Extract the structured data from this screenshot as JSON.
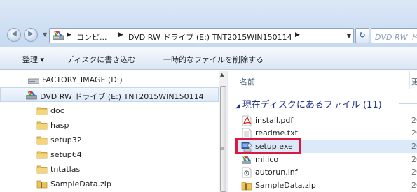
{
  "address_bar": {
    "crumbs": [
      "コンピ...",
      "DVD RW ドライブ (E:) TNT2015WIN150114"
    ],
    "search_placeholder": "DVD RW ドライブ"
  },
  "command_bar": {
    "organize": "整理 ▾",
    "burn": "ディスクに書き込む",
    "delete_temp": "一時的なファイルを削除する"
  },
  "nav_pane": {
    "items": [
      {
        "label": "FACTORY_IMAGE (D:)",
        "icon": "drive-icon",
        "selected": false
      },
      {
        "label": "DVD RW ドライブ (E:) TNT2015WIN150114",
        "icon": "dvd-drive-icon",
        "selected": true
      },
      {
        "label": "doc",
        "icon": "folder-icon"
      },
      {
        "label": "hasp",
        "icon": "folder-icon"
      },
      {
        "label": "setup32",
        "icon": "folder-icon"
      },
      {
        "label": "setup64",
        "icon": "folder-icon"
      },
      {
        "label": "tntatlas",
        "icon": "folder-icon"
      },
      {
        "label": "SampleData.zip",
        "icon": "zip-icon"
      }
    ]
  },
  "file_list": {
    "columns": {
      "name": "名前",
      "date": "更"
    },
    "group_title": "現在ディスクにあるファイル (11)",
    "files": [
      {
        "name": "install.pdf",
        "date": "20",
        "icon": "pdf-icon"
      },
      {
        "name": "readme.txt",
        "date": "20",
        "icon": "text-file-icon"
      },
      {
        "name": "setup.exe",
        "date": "20",
        "icon": "setup-exe-icon",
        "highlighted": true
      },
      {
        "name": "mi.ico",
        "date": "20",
        "icon": "ico-file-icon"
      },
      {
        "name": "autorun.inf",
        "date": "20",
        "icon": "inf-file-icon"
      },
      {
        "name": "SampleData.zip",
        "date": "20",
        "icon": "zip-icon"
      }
    ]
  },
  "colors": {
    "highlight_box": "#d9193f",
    "group_title": "#1e3287",
    "selected_row": "#dde9f7"
  }
}
